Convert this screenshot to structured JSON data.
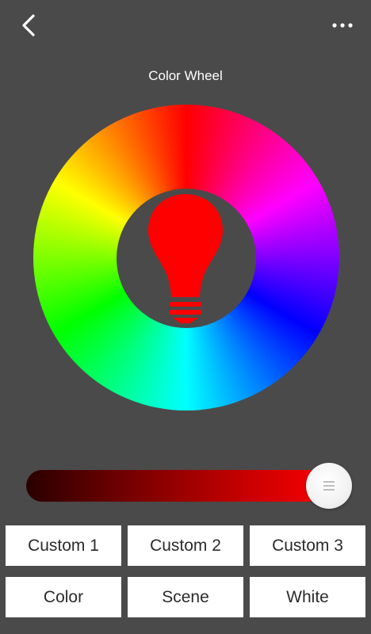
{
  "header": {
    "title": "Color Wheel",
    "back_icon": "chevron-left-icon",
    "more_icon": "more-horizontal-icon"
  },
  "color_wheel": {
    "selected_color": "#ff0000",
    "center_icon": "lightbulb-icon"
  },
  "brightness_slider": {
    "level_percent": 100,
    "start_color": "#2a0000",
    "end_color": "#ff0000"
  },
  "buttons": {
    "custom1": "Custom 1",
    "custom2": "Custom 2",
    "custom3": "Custom 3",
    "color": "Color",
    "scene": "Scene",
    "white": "White"
  }
}
